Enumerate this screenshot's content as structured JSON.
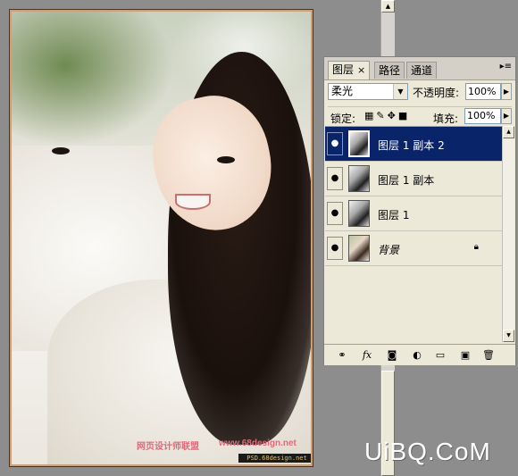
{
  "canvas": {
    "watermark_cn": "网页设计师联盟",
    "watermark_url": "www.68design.net",
    "watermark_small": "PSD.68design.net"
  },
  "panel": {
    "tabs": [
      {
        "label": "图层",
        "active": true
      },
      {
        "label": "路径",
        "active": false
      },
      {
        "label": "通道",
        "active": false
      }
    ],
    "blend_mode": "柔光",
    "opacity_label": "不透明度:",
    "opacity_value": "100%",
    "lock_label": "锁定:",
    "fill_label": "填充:",
    "fill_value": "100%",
    "layers": [
      {
        "name": "图层 1 副本 2",
        "selected": true
      },
      {
        "name": "图层 1 副本",
        "selected": false
      },
      {
        "name": "图层 1",
        "selected": false
      },
      {
        "name": "背景",
        "selected": false,
        "locked": true
      }
    ],
    "bottom_icons": [
      "link-icon",
      "fx-icon",
      "mask-icon",
      "adjustment-icon",
      "folder-icon",
      "new-layer-icon",
      "trash-icon"
    ]
  },
  "logo": "UiBQ.CoM"
}
